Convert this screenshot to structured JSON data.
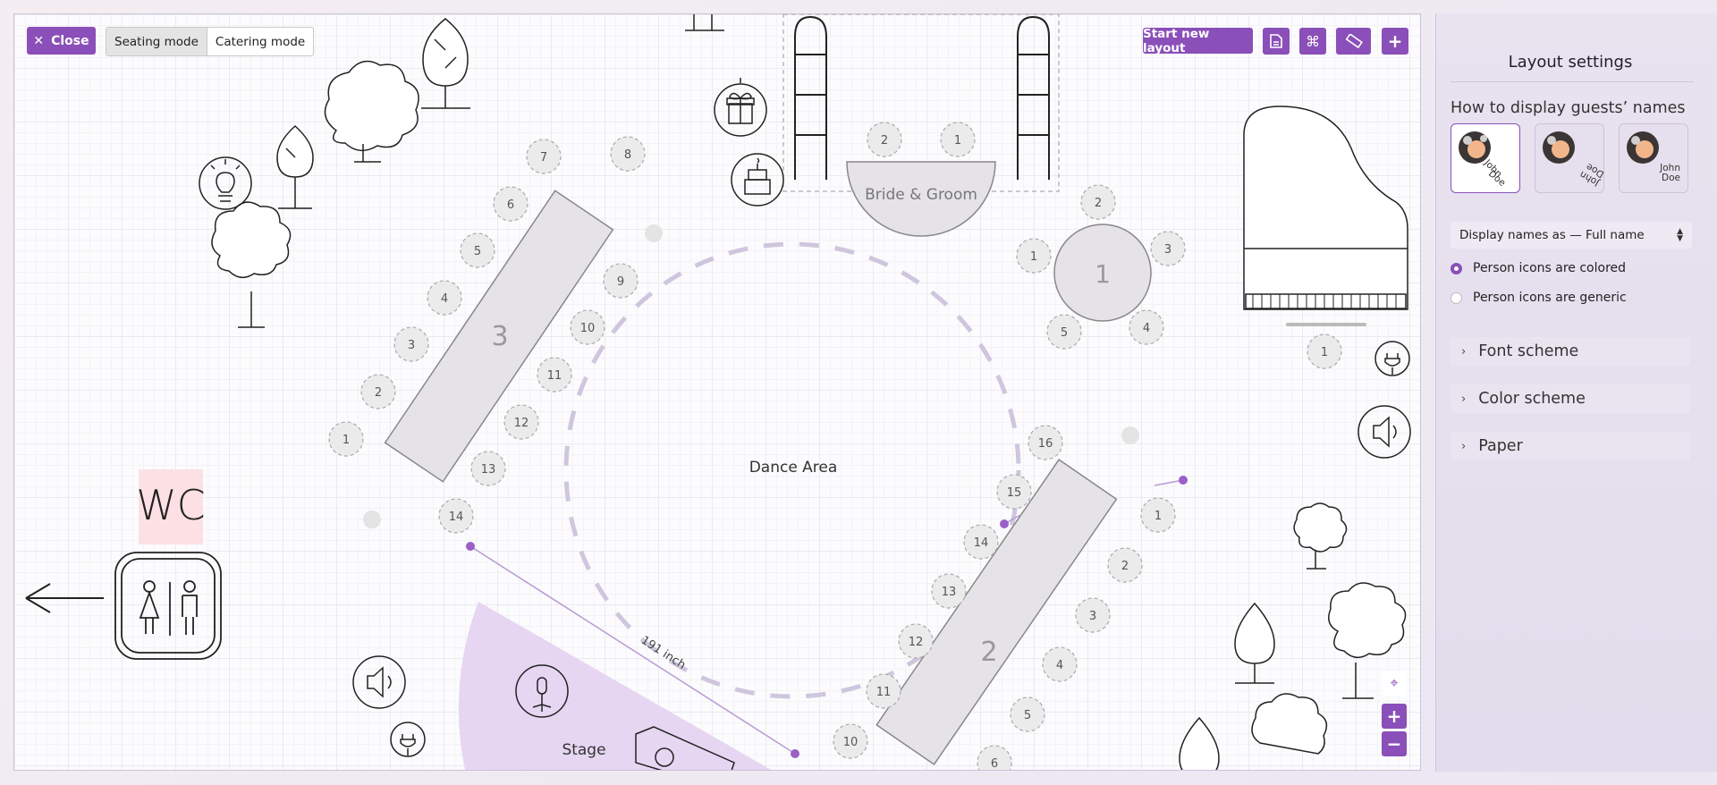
{
  "toolbar": {
    "close_label": "Close",
    "modes": [
      "Seating mode",
      "Catering mode"
    ],
    "active_mode": "Seating mode",
    "start_new_layout_label": "Start new layout",
    "action_icons": [
      "document-icon",
      "command-icon",
      "ruler-icon",
      "plus-icon"
    ]
  },
  "floorplan": {
    "dance_area_label": "Dance Area",
    "stage_label": "Stage",
    "wc_label": "WC",
    "bride_groom_label": "Bride & Groom",
    "measurement_label": "191 inch",
    "bride_groom_seats": [
      "2",
      "1"
    ],
    "table_1": {
      "label": "1",
      "seats": [
        "1",
        "2",
        "3",
        "4",
        "5"
      ]
    },
    "table_2": {
      "label": "2",
      "seats": [
        "1",
        "2",
        "3",
        "4",
        "5",
        "6",
        "10",
        "11",
        "12",
        "13",
        "14",
        "15",
        "16"
      ]
    },
    "table_3": {
      "label": "3",
      "seats": [
        "1",
        "2",
        "3",
        "4",
        "5",
        "6",
        "7",
        "8",
        "9",
        "10",
        "11",
        "12",
        "13",
        "14"
      ]
    },
    "piano_seat": "1"
  },
  "zoom_controls": {
    "zoom_in": "+",
    "zoom_out": "−"
  },
  "panel": {
    "title": "Layout settings",
    "subtitle": "How to display guests’ names",
    "name_cards": [
      {
        "first": "John",
        "last": "Doe",
        "selected": true
      },
      {
        "first": "John",
        "last": "Doe",
        "selected": false
      },
      {
        "first": "John",
        "last": "Doe",
        "selected": false
      }
    ],
    "display_names_select": "Display names as — Full name",
    "person_icon_options": [
      {
        "label": "Person icons are colored",
        "selected": true
      },
      {
        "label": "Person icons are generic",
        "selected": false
      }
    ],
    "sections": [
      "Font scheme",
      "Color scheme",
      "Paper"
    ]
  },
  "colors": {
    "accent": "#8a4fb8",
    "table_fill": "#e6e3e8",
    "stage_fill": "#e6d6f2"
  }
}
